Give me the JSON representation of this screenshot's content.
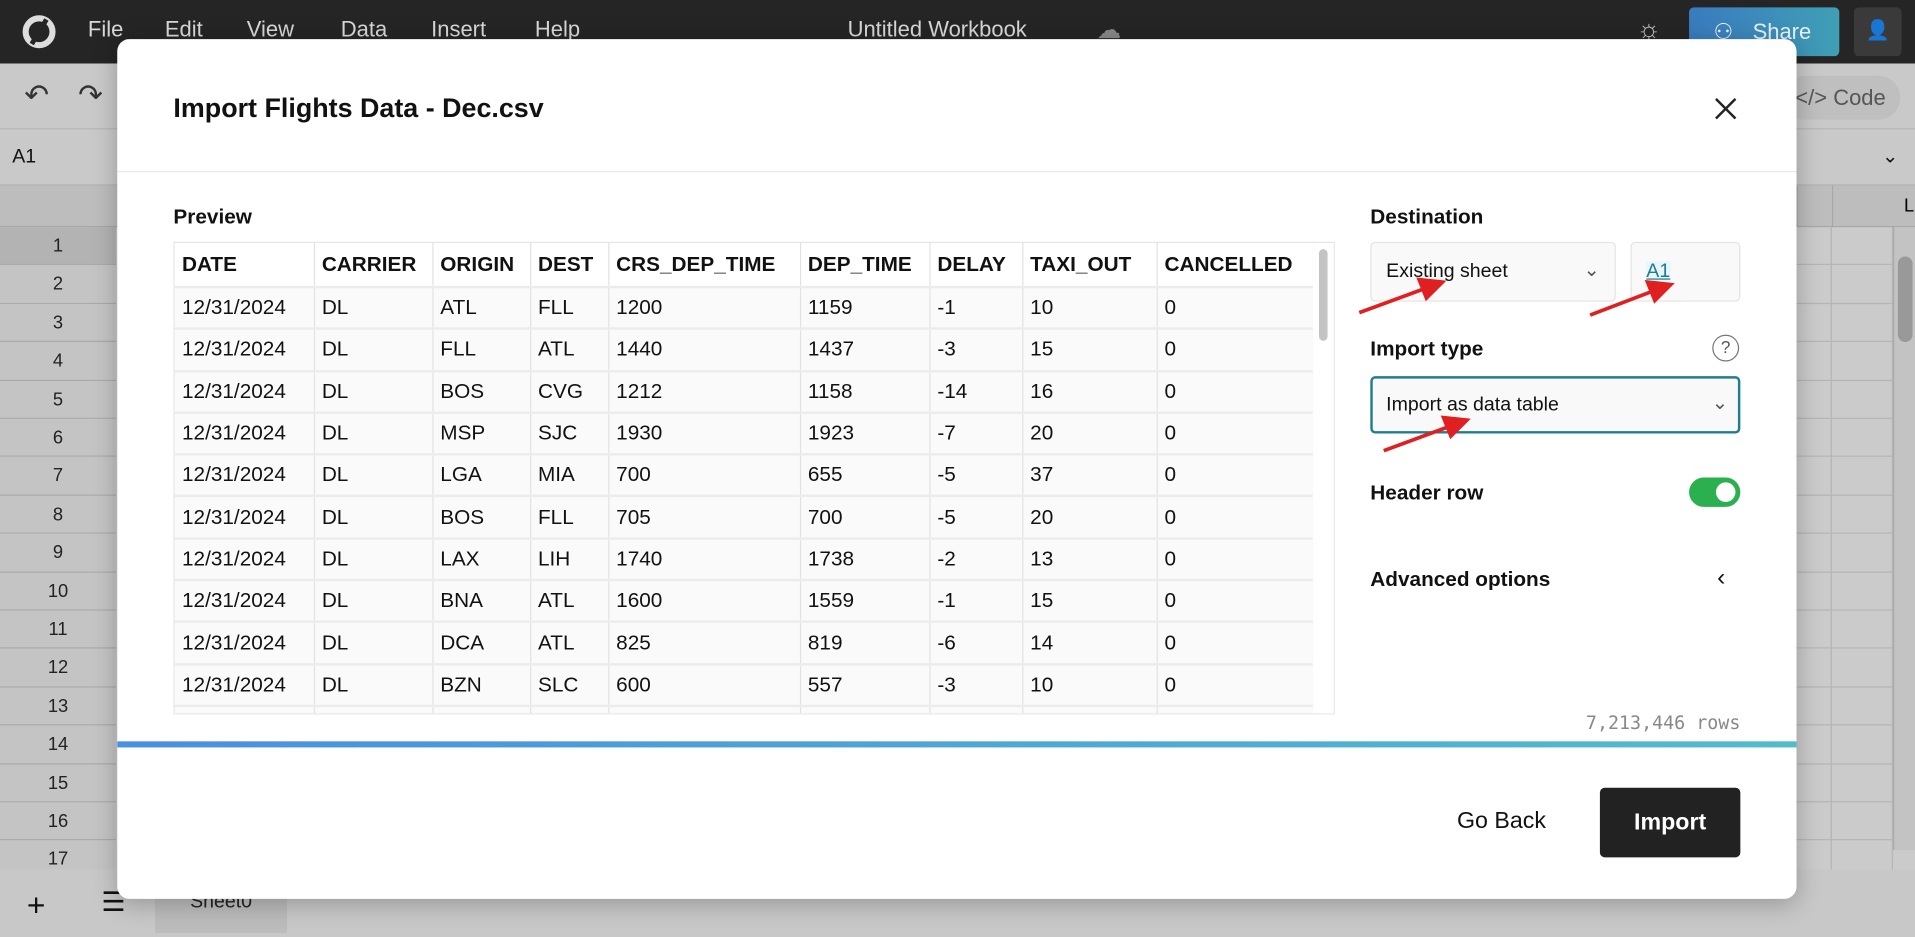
{
  "app": {
    "menu": [
      "File",
      "Edit",
      "View",
      "Data",
      "Insert",
      "Help"
    ],
    "title": "Untitled Workbook",
    "share_label": "Share",
    "code_label": "</> Code",
    "cell_ref": "A1",
    "col_letter": "L",
    "rows": [
      "1",
      "2",
      "3",
      "4",
      "5",
      "6",
      "7",
      "8",
      "9",
      "10",
      "11",
      "12",
      "13",
      "14",
      "15",
      "16",
      "17"
    ],
    "sheet_tab": "Sheet0"
  },
  "dialog": {
    "title": "Import Flights Data - Dec.csv",
    "preview_label": "Preview",
    "columns": [
      "DATE",
      "CARRIER",
      "ORIGIN",
      "DEST",
      "CRS_DEP_TIME",
      "DEP_TIME",
      "DELAY",
      "TAXI_OUT",
      "CANCELLED"
    ],
    "rows": [
      [
        "12/31/2024",
        "DL",
        "ATL",
        "FLL",
        "1200",
        "1159",
        "-1",
        "10",
        "0"
      ],
      [
        "12/31/2024",
        "DL",
        "FLL",
        "ATL",
        "1440",
        "1437",
        "-3",
        "15",
        "0"
      ],
      [
        "12/31/2024",
        "DL",
        "BOS",
        "CVG",
        "1212",
        "1158",
        "-14",
        "16",
        "0"
      ],
      [
        "12/31/2024",
        "DL",
        "MSP",
        "SJC",
        "1930",
        "1923",
        "-7",
        "20",
        "0"
      ],
      [
        "12/31/2024",
        "DL",
        "LGA",
        "MIA",
        "700",
        "655",
        "-5",
        "37",
        "0"
      ],
      [
        "12/31/2024",
        "DL",
        "BOS",
        "FLL",
        "705",
        "700",
        "-5",
        "20",
        "0"
      ],
      [
        "12/31/2024",
        "DL",
        "LAX",
        "LIH",
        "1740",
        "1738",
        "-2",
        "13",
        "0"
      ],
      [
        "12/31/2024",
        "DL",
        "BNA",
        "ATL",
        "1600",
        "1559",
        "-1",
        "15",
        "0"
      ],
      [
        "12/31/2024",
        "DL",
        "DCA",
        "ATL",
        "825",
        "819",
        "-6",
        "14",
        "0"
      ],
      [
        "12/31/2024",
        "DL",
        "BZN",
        "SLC",
        "600",
        "557",
        "-3",
        "10",
        "0"
      ]
    ],
    "destination_label": "Destination",
    "destination_value": "Existing sheet",
    "destination_cell": "A1",
    "import_type_label": "Import type",
    "import_type_value": "Import as data table",
    "header_row_label": "Header row",
    "header_row_on": true,
    "advanced_label": "Advanced options",
    "row_count": "7,213,446 rows",
    "go_back_label": "Go Back",
    "import_label": "Import",
    "colors": {
      "accent": "#1f7d8f",
      "toggle": "#2bb04f",
      "arrow": "#e02020",
      "import_btn": "#222222"
    }
  }
}
